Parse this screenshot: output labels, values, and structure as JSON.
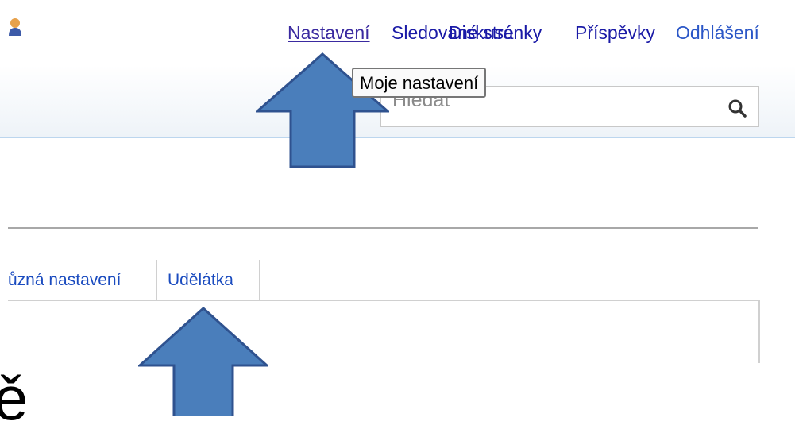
{
  "user_icon": "user-icon",
  "nav": {
    "items": [
      "Diskuse",
      "Nastavení",
      "Sledované stránky",
      "Příspěvky",
      "Odhlášení"
    ],
    "active": "Nastavení"
  },
  "tooltip": "Moje nastavení",
  "search": {
    "placeholder": "Hledat",
    "icon": "search-icon"
  },
  "tabs": [
    "ůzná nastavení",
    "Udělátka"
  ],
  "fragment": "ě",
  "colors": {
    "arrow_fill": "#4a7ebb",
    "arrow_stroke": "#2f528f",
    "link": "#1a1aa6",
    "header_border": "#bcd6ee"
  }
}
